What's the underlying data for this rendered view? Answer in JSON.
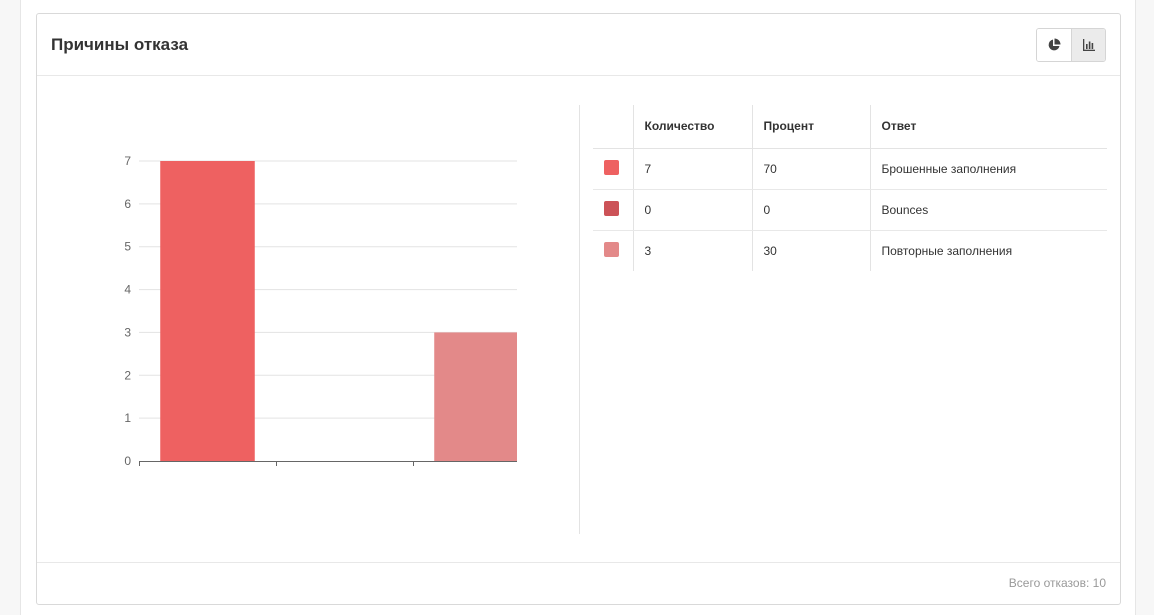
{
  "panel": {
    "title": "Причины отказа",
    "buttons": [
      {
        "icon": "pie-chart-icon",
        "active": false
      },
      {
        "icon": "bar-chart-icon",
        "active": true
      }
    ],
    "footer_total": "Всего отказов: 10"
  },
  "table": {
    "headers": [
      "",
      "Количество",
      "Процент",
      "Ответ"
    ],
    "rows": [
      {
        "color": "#ee6161",
        "count": "7",
        "percent": "70",
        "answer": "Брошенные заполнения"
      },
      {
        "color": "#cc5257",
        "count": "0",
        "percent": "0",
        "answer": "Bounces"
      },
      {
        "color": "#e38989",
        "count": "3",
        "percent": "30",
        "answer": "Повторные заполнения"
      }
    ]
  },
  "chart_data": {
    "type": "bar",
    "categories": [
      "Брошенные заполнения",
      "Bounces",
      "Повторные заполнения"
    ],
    "values": [
      7,
      0,
      3
    ],
    "colors": [
      "#ee6161",
      "#cc5257",
      "#e38989"
    ],
    "ylim": [
      0,
      7
    ],
    "yticks": [
      0,
      1,
      2,
      3,
      4,
      5,
      6,
      7
    ],
    "grid": true,
    "show_x_tick_labels": false
  }
}
